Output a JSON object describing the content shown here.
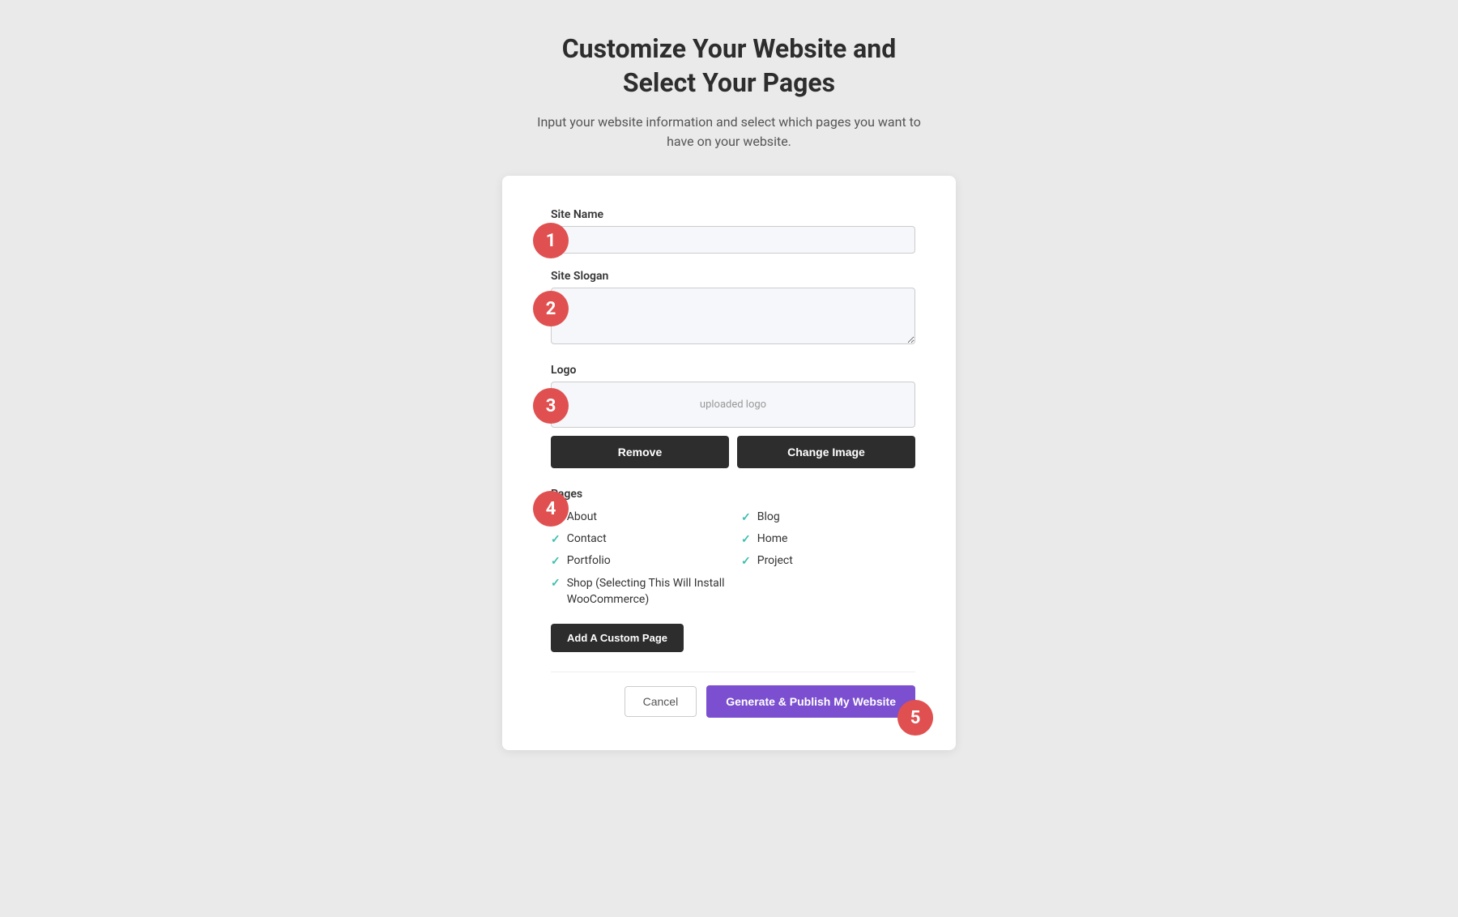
{
  "header": {
    "title_line1": "Customize Your Website and",
    "title_line2": "Select Your Pages",
    "subtitle": "Input your website information and select which pages you want to have on your website."
  },
  "form": {
    "site_name_label": "Site Name",
    "site_name_placeholder": "",
    "site_slogan_label": "Site Slogan",
    "site_slogan_placeholder": "",
    "logo_label": "Logo",
    "logo_preview_text": "uploaded logo",
    "remove_button": "Remove",
    "change_image_button": "Change Image",
    "pages_label": "Pages",
    "pages": [
      {
        "label": "About",
        "checked": true,
        "col": 1
      },
      {
        "label": "Blog",
        "checked": true,
        "col": 2
      },
      {
        "label": "Contact",
        "checked": true,
        "col": 1
      },
      {
        "label": "Home",
        "checked": true,
        "col": 2
      },
      {
        "label": "Portfolio",
        "checked": true,
        "col": 1
      },
      {
        "label": "Project",
        "checked": true,
        "col": 2
      }
    ],
    "shop_page_label": "Shop (Selecting This Will Install WooCommerce)",
    "shop_checked": true,
    "add_custom_page_button": "Add A Custom Page",
    "cancel_button": "Cancel",
    "publish_button": "Generate & Publish My Website"
  },
  "steps": {
    "step1": "1",
    "step2": "2",
    "step3": "3",
    "step4": "4",
    "step5": "5"
  },
  "colors": {
    "badge_bg": "#e05050",
    "check_color": "#3dbfad",
    "publish_btn_bg": "#7b4fcf"
  }
}
